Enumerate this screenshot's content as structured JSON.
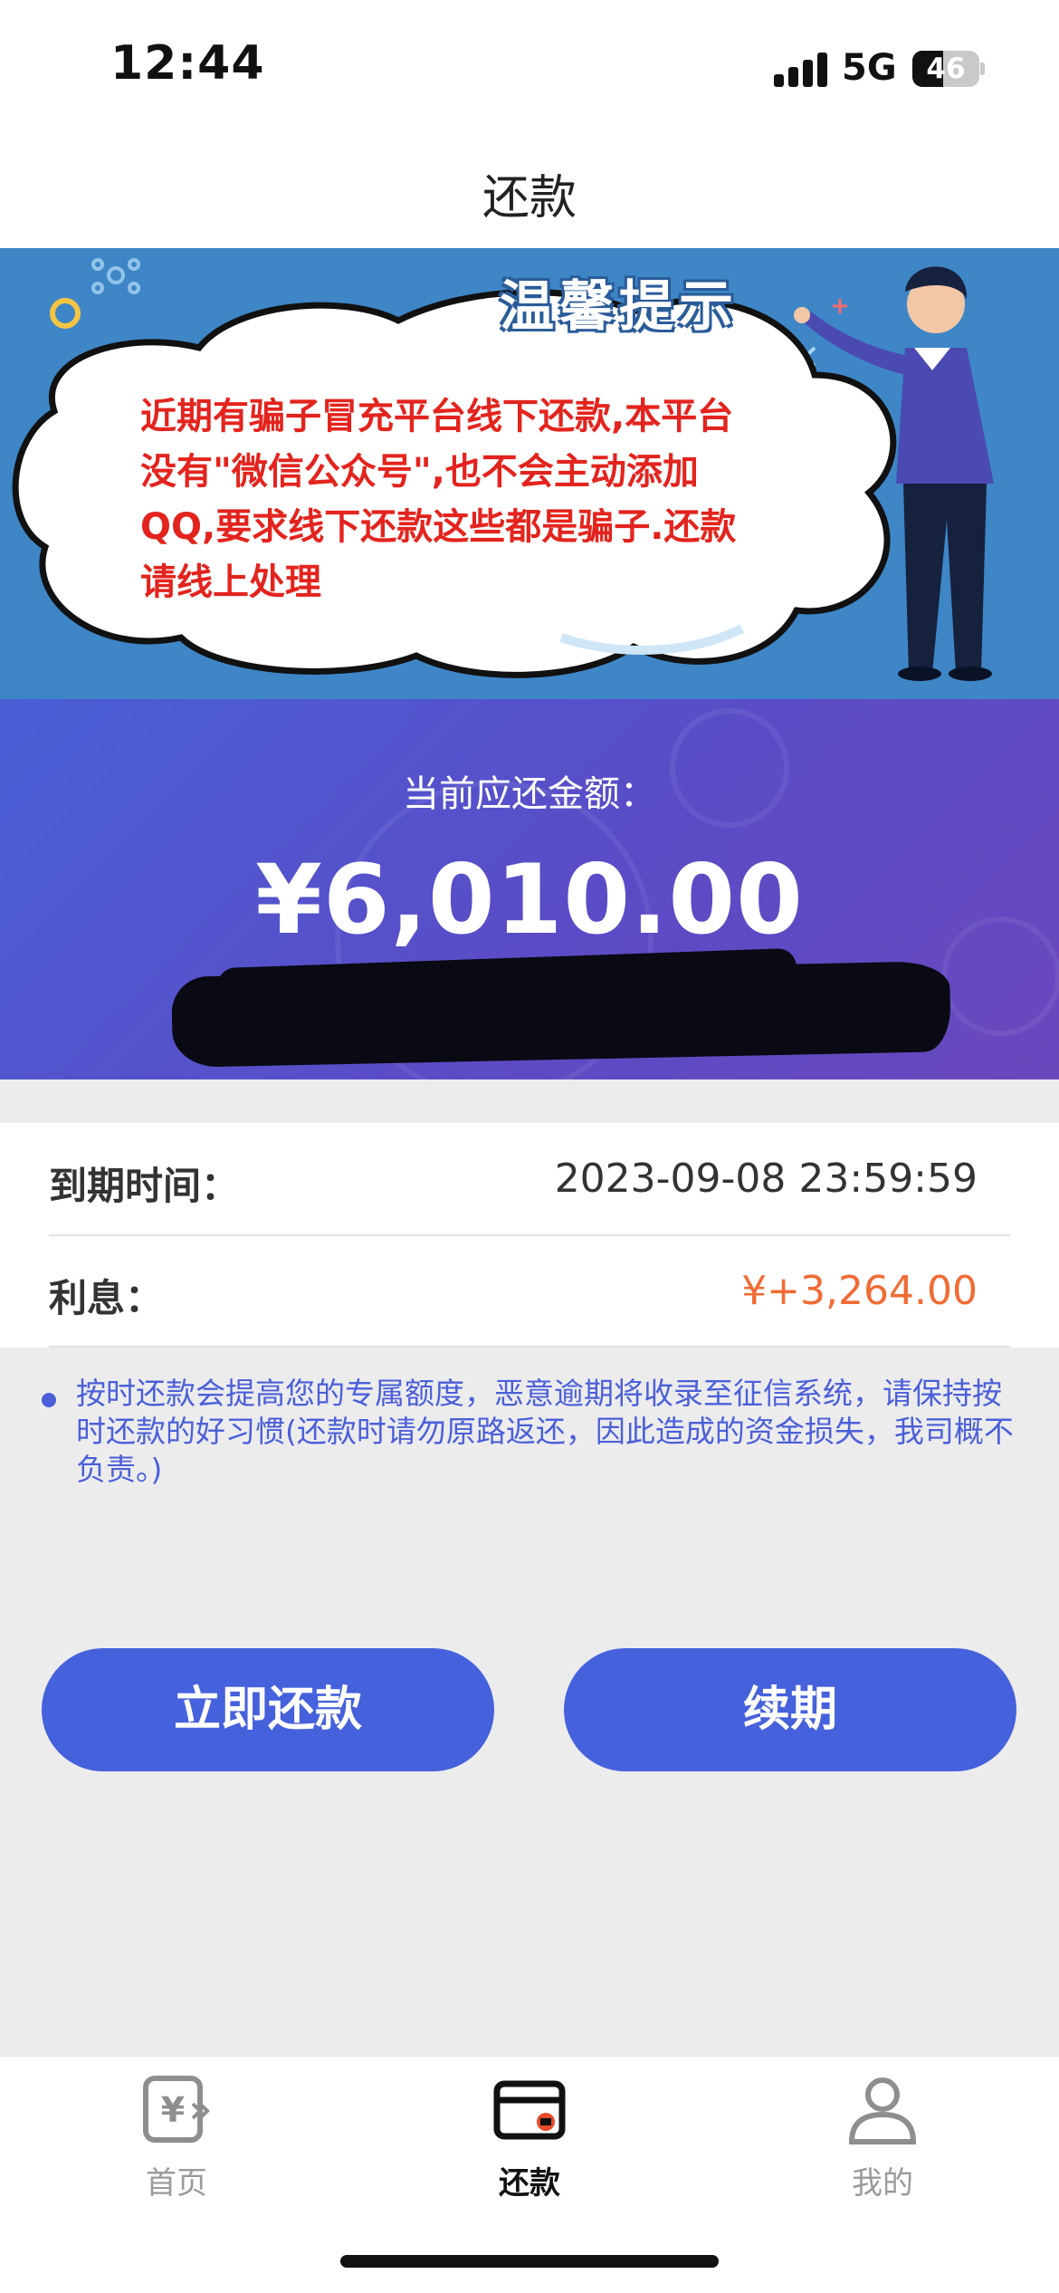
{
  "status_bar": {
    "time": "12:44",
    "network": "5G",
    "battery_level": "46",
    "battery_percent": 46,
    "icons": [
      "signal-icon",
      "battery-icon"
    ]
  },
  "nav": {
    "title": "还款"
  },
  "banner": {
    "title": "温馨提示",
    "text": "近期有骗子冒充平台线下还款,本平台没有\"微信公众号\",也不会主动添加QQ,要求线下还款这些都是骗子.还款请线上处理"
  },
  "amount": {
    "label": "当前应还金额：",
    "value": "¥6,010.00"
  },
  "info": {
    "due_label": "到期时间：",
    "due_value": "2023-09-08 23:59:59",
    "interest_label": "利息：",
    "interest_value": "¥+3,264.00"
  },
  "notice": {
    "text": "按时还款会提高您的专属额度，恶意逾期将收录至征信系统，请保持按时还款的好习惯(还款时请勿原路返还，因此造成的资金损失，我司概不负责。)"
  },
  "buttons": {
    "pay_label": "立即还款",
    "renew_label": "续期"
  },
  "tabs": [
    {
      "label": "首页",
      "icon": "yuan-card-icon",
      "active": false
    },
    {
      "label": "还款",
      "icon": "wallet-card-icon",
      "active": true
    },
    {
      "label": "我的",
      "icon": "user-icon",
      "active": false
    }
  ],
  "colors": {
    "accent": "#4661dc",
    "banner_bg": "#3e86c6",
    "warning_red": "#e3241e",
    "interest_orange": "#f06b35"
  }
}
